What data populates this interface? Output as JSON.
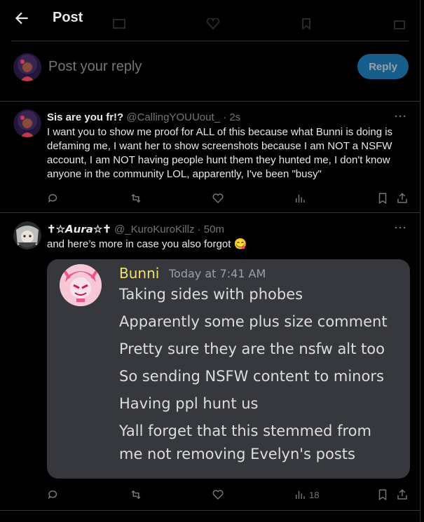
{
  "header": {
    "title": "Post"
  },
  "composer": {
    "placeholder": "Post your reply",
    "reply_label": "Reply"
  },
  "tweets": [
    {
      "display_name": "Sis are you fr!?",
      "handle": "@CallingYOUUout_",
      "time": "· 2s",
      "text": "I want you to show me proof for ALL of this because what Bunni is doing is defaming me, I want her to show screenshots because I am NOT a NSFW account, I am NOT having people hunt them they hunted me, I don't know anyone in the community LOL, apparently, I've been \"busy\"",
      "views": ""
    },
    {
      "display_name": "✝︎☆𝘼𝙪𝙧𝙖☆✝︎",
      "handle": "@_KuroKuroKillz",
      "time": "· 50m",
      "text": "and here’s more in case you also forgot 😋",
      "views": "18"
    }
  ],
  "embedded_message": {
    "author": "Bunni",
    "time": "Today at 7:41 AM",
    "lines": [
      "Taking sides with phobes",
      "Apparently some plus size comment",
      "Pretty sure they are the nsfw alt too",
      "So sending NSFW content to minors",
      "Having ppl hunt us",
      "Yall forget that this stemmed from",
      "me not removing Evelyn's posts"
    ]
  },
  "colors": {
    "reply_button": "#1d6fa5",
    "discord_name": "#f5e067",
    "card_bg": "#36383e",
    "muted": "#71767b"
  }
}
